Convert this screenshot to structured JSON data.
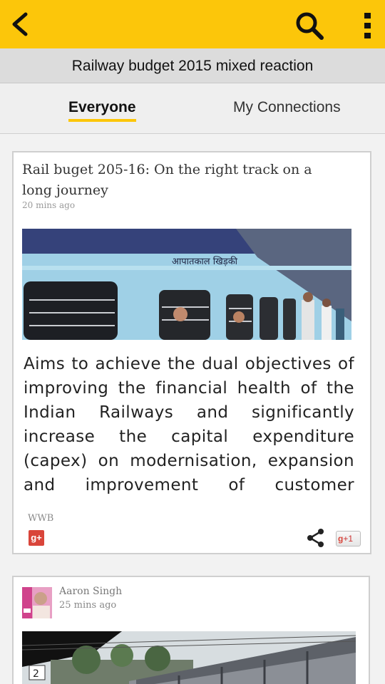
{
  "app_bar": {
    "back_icon": "arrow-back-icon",
    "search_icon": "search-icon",
    "more_icon": "more-vert-icon",
    "color": "#fcc60a"
  },
  "topic_title": "Railway budget 2015 mixed reaction",
  "tabs": [
    {
      "label": "Everyone",
      "active": true
    },
    {
      "label": "My Connections",
      "active": false
    }
  ],
  "posts": [
    {
      "title": "Rail buget 205-16: On the right track on a long journey",
      "time": "20 mins ago",
      "image": "train-photo",
      "body": "Aims to achieve the dual objectives of improving the financial health of the Indian Railways and significantly increase the capital expenditure (capex) on modernisation, expansion and improvement of customer amenities &",
      "source": "WWB",
      "gplus_label": "g+",
      "plusone_label": "+1"
    },
    {
      "author": "Aaron Singh",
      "time": "25 mins ago",
      "image": "station-photo"
    }
  ]
}
